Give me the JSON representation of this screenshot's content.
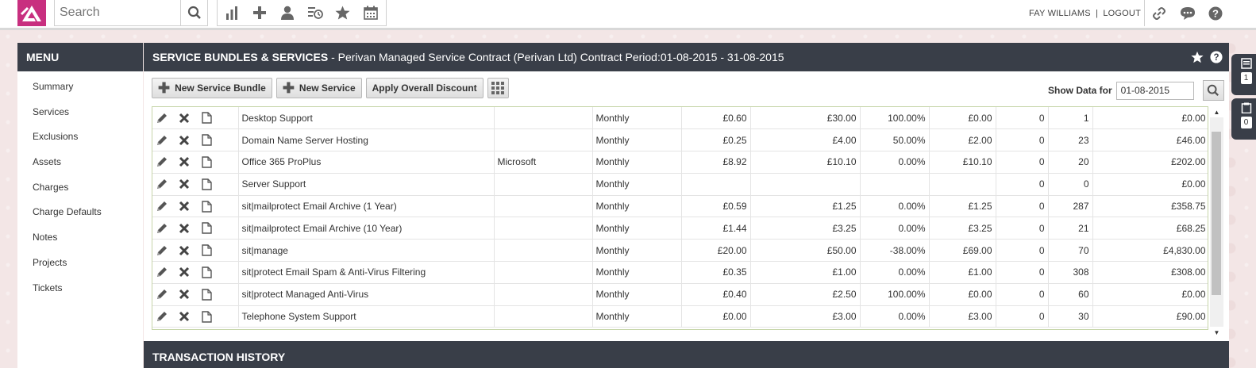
{
  "topbar": {
    "search_placeholder": "Search",
    "icons": [
      "reports-icon",
      "add-icon",
      "user-icon",
      "history-icon",
      "star-icon",
      "calendar-icon"
    ],
    "user_name": "FAY WILLIAMS",
    "separator": "|",
    "logout_label": "LOGOUT",
    "right_icons": [
      "link-icon",
      "chat-icon",
      "help-icon"
    ]
  },
  "menu": {
    "title": "MENU",
    "items": [
      {
        "label": "Summary"
      },
      {
        "label": "Services"
      },
      {
        "label": "Exclusions"
      },
      {
        "label": "Assets"
      },
      {
        "label": "Charges"
      },
      {
        "label": "Charge Defaults"
      },
      {
        "label": "Notes"
      },
      {
        "label": "Projects"
      },
      {
        "label": "Tickets"
      }
    ]
  },
  "main": {
    "title_bold": "SERVICE BUNDLES & SERVICES",
    "title_rest": " - Perivan Managed Service Contract (Perivan Ltd) Contract Period:01-08-2015 - 31-08-2015",
    "buttons": {
      "new_bundle": "New Service Bundle",
      "new_service": "New Service",
      "apply_discount": "Apply Overall Discount"
    },
    "show_data_label": "Show Data for",
    "show_data_value": "01-08-2015",
    "section2_title": "TRANSACTION HISTORY"
  },
  "table": {
    "rows": [
      {
        "name": "Desktop Support",
        "vendor": "",
        "freq": "Monthly",
        "cost": "£0.60",
        "price": "£30.00",
        "disc": "100.00%",
        "net": "£0.00",
        "c1": "0",
        "qty": "1",
        "total": "£0.00"
      },
      {
        "name": "Domain Name Server Hosting",
        "vendor": "",
        "freq": "Monthly",
        "cost": "£0.25",
        "price": "£4.00",
        "disc": "50.00%",
        "net": "£2.00",
        "c1": "0",
        "qty": "23",
        "total": "£46.00"
      },
      {
        "name": "Office 365 ProPlus",
        "vendor": "Microsoft",
        "freq": "Monthly",
        "cost": "£8.92",
        "price": "£10.10",
        "disc": "0.00%",
        "net": "£10.10",
        "c1": "0",
        "qty": "20",
        "total": "£202.00"
      },
      {
        "name": "Server Support",
        "vendor": "",
        "freq": "Monthly",
        "cost": "",
        "price": "",
        "disc": "",
        "net": "",
        "c1": "0",
        "qty": "0",
        "total": "£0.00"
      },
      {
        "name": "sit|mailprotect Email Archive (1 Year)",
        "vendor": "",
        "freq": "Monthly",
        "cost": "£0.59",
        "price": "£1.25",
        "disc": "0.00%",
        "net": "£1.25",
        "c1": "0",
        "qty": "287",
        "total": "£358.75"
      },
      {
        "name": "sit|mailprotect Email Archive (10 Year)",
        "vendor": "",
        "freq": "Monthly",
        "cost": "£1.44",
        "price": "£3.25",
        "disc": "0.00%",
        "net": "£3.25",
        "c1": "0",
        "qty": "21",
        "total": "£68.25"
      },
      {
        "name": "sit|manage",
        "vendor": "",
        "freq": "Monthly",
        "cost": "£20.00",
        "price": "£50.00",
        "disc": "-38.00%",
        "net": "£69.00",
        "c1": "0",
        "qty": "70",
        "total": "£4,830.00"
      },
      {
        "name": "sit|protect Email Spam & Anti-Virus Filtering",
        "vendor": "",
        "freq": "Monthly",
        "cost": "£0.35",
        "price": "£1.00",
        "disc": "0.00%",
        "net": "£1.00",
        "c1": "0",
        "qty": "308",
        "total": "£308.00"
      },
      {
        "name": "sit|protect Managed Anti-Virus",
        "vendor": "",
        "freq": "Monthly",
        "cost": "£0.40",
        "price": "£2.50",
        "disc": "100.00%",
        "net": "£0.00",
        "c1": "0",
        "qty": "60",
        "total": "£0.00"
      },
      {
        "name": "Telephone System Support",
        "vendor": "",
        "freq": "Monthly",
        "cost": "£0.00",
        "price": "£3.00",
        "disc": "0.00%",
        "net": "£3.00",
        "c1": "0",
        "qty": "30",
        "total": "£90.00"
      }
    ]
  },
  "side_tabs": [
    {
      "icon": "list-icon",
      "count": "1"
    },
    {
      "icon": "clipboard-icon",
      "count": "0"
    }
  ],
  "colors": {
    "brand": "#c82f7f",
    "header_bg": "#393e48"
  }
}
